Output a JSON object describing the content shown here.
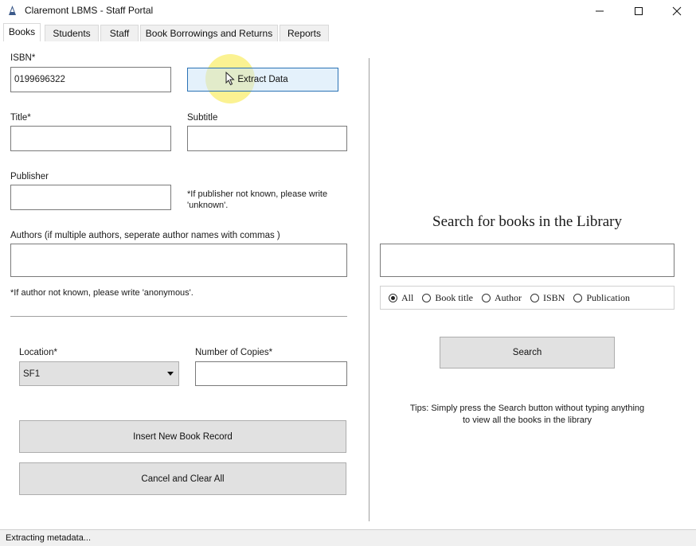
{
  "window": {
    "title": "Claremont LBMS - Staff Portal",
    "minimize": "—",
    "maximize": "☐",
    "close": "✕"
  },
  "tabs": [
    {
      "label": "Books",
      "active": true
    },
    {
      "label": "Students",
      "active": false
    },
    {
      "label": "Staff",
      "active": false
    },
    {
      "label": "Book Borrowings and Returns",
      "active": false
    },
    {
      "label": "Reports",
      "active": false
    }
  ],
  "form": {
    "isbn_label": "ISBN*",
    "isbn_value": "0199696322",
    "extract_button": "Extract Data",
    "title_label": "Title*",
    "title_value": "",
    "subtitle_label": "Subtitle",
    "subtitle_value": "",
    "publisher_label": "Publisher",
    "publisher_value": "",
    "publisher_note": "*If publisher not known, please write 'unknown'.",
    "authors_label": "Authors (if multiple authors, seperate author names with commas )",
    "authors_value": "",
    "authors_note": "*If author not known, please write 'anonymous'.",
    "location_label": "Location*",
    "location_value": "SF1",
    "copies_label": "Number of Copies*",
    "copies_value": "",
    "insert_button": "Insert New Book Record",
    "cancel_button": "Cancel and Clear All"
  },
  "search": {
    "heading": "Search for books in the Library",
    "query": "",
    "options": [
      {
        "label": "All",
        "checked": true
      },
      {
        "label": "Book title",
        "checked": false
      },
      {
        "label": "Author",
        "checked": false
      },
      {
        "label": "ISBN",
        "checked": false
      },
      {
        "label": "Publication",
        "checked": false
      }
    ],
    "button": "Search",
    "tip_line1": "Tips: Simply press the Search button without typing anything",
    "tip_line2": "to view all the books in the library"
  },
  "status": {
    "text": "Extracting metadata..."
  }
}
